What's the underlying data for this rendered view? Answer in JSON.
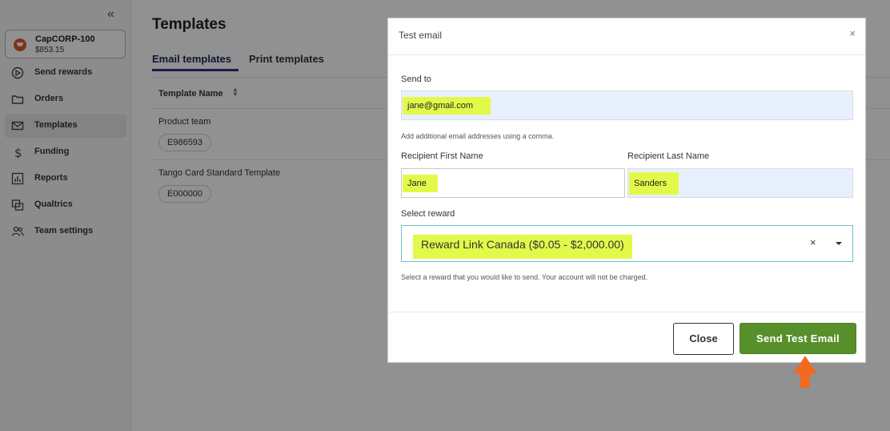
{
  "sidebar": {
    "account": {
      "name": "CapCORP-100",
      "balance": "$853.15"
    },
    "items": [
      {
        "label": "Send rewards",
        "icon": "send-icon"
      },
      {
        "label": "Orders",
        "icon": "folder-icon"
      },
      {
        "label": "Templates",
        "icon": "mail-icon",
        "active": true
      },
      {
        "label": "Funding",
        "icon": "dollar-icon"
      },
      {
        "label": "Reports",
        "icon": "chart-icon"
      },
      {
        "label": "Qualtrics",
        "icon": "qualtrics-icon"
      },
      {
        "label": "Team settings",
        "icon": "team-icon"
      }
    ]
  },
  "main": {
    "title": "Templates",
    "tabs": [
      {
        "label": "Email templates",
        "active": true
      },
      {
        "label": "Print templates",
        "active": false
      }
    ],
    "table": {
      "column": "Template Name",
      "rows": [
        {
          "name": "Product team",
          "id": "E986593"
        },
        {
          "name": "Tango Card Standard Template",
          "id": "E000000"
        }
      ]
    }
  },
  "modal": {
    "title": "Test email",
    "close_icon": "×",
    "send_to": {
      "label": "Send to",
      "value": "jane@gmail.com",
      "helper": "Add additional email addresses using a comma."
    },
    "first_name": {
      "label": "Recipient First Name",
      "value": "Jane"
    },
    "last_name": {
      "label": "Recipient Last Name",
      "value": "Sanders"
    },
    "reward": {
      "label": "Select reward",
      "value": "Reward Link Canada ($0.05 - $2,000.00)",
      "clear": "×",
      "helper": "Select a reward that you would like to send. Your account will not be charged."
    },
    "buttons": {
      "close": "Close",
      "send": "Send Test Email"
    }
  },
  "colors": {
    "overlay": "rgba(0,0,0,0.43)",
    "primary_button": "#57902a",
    "highlight": "#e3f94a",
    "annotation_arrow": "#f26a22",
    "tab_underline": "#3d2a7a"
  }
}
